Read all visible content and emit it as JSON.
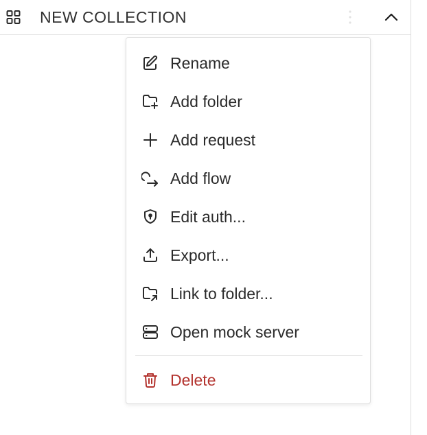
{
  "collection": {
    "title": "NEW COLLECTION",
    "icons": {
      "collection": "grid-icon",
      "more": "kebab-icon",
      "toggle": "chevron-up-icon"
    }
  },
  "menu": {
    "items": [
      {
        "label": "Rename",
        "icon": "pencil-square-icon"
      },
      {
        "label": "Add folder",
        "icon": "folder-plus-icon"
      },
      {
        "label": "Add request",
        "icon": "plus-icon"
      },
      {
        "label": "Add flow",
        "icon": "flow-arrow-icon"
      },
      {
        "label": "Edit auth...",
        "icon": "shield-icon"
      },
      {
        "label": "Export...",
        "icon": "upload-icon"
      },
      {
        "label": "Link to folder...",
        "icon": "folder-link-icon"
      },
      {
        "label": "Open mock server",
        "icon": "server-icon"
      }
    ],
    "danger": {
      "label": "Delete",
      "icon": "trash-icon"
    }
  },
  "colors": {
    "text": "#2a2a2a",
    "danger": "#b3332e",
    "border": "#dedede"
  }
}
